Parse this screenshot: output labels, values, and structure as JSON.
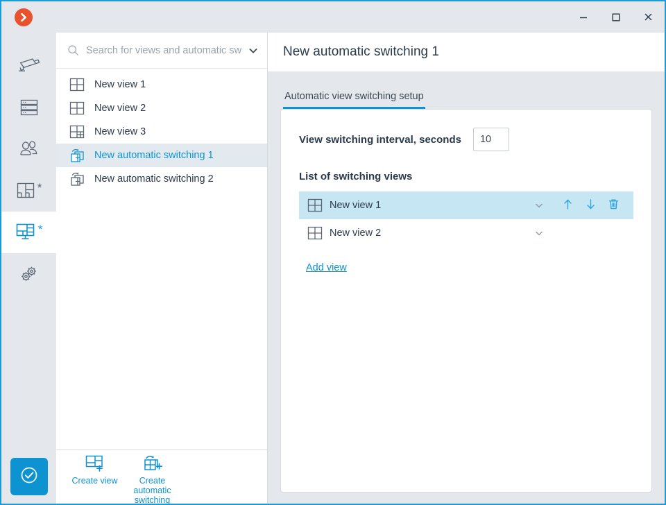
{
  "window": {
    "logo_icon": "chevron-right-circle-logo",
    "minimize_label": "—",
    "maximize_label": "□",
    "close_label": "✕"
  },
  "rail": {
    "items": [
      {
        "name": "cameras",
        "icon": "cctv-camera-icon",
        "star": "",
        "active": false
      },
      {
        "name": "servers",
        "icon": "server-stack-icon",
        "star": "",
        "active": false
      },
      {
        "name": "users",
        "icon": "users-group-icon",
        "star": "",
        "active": false
      },
      {
        "name": "layouts",
        "icon": "grid-layout-icon",
        "star": "*",
        "active": false
      },
      {
        "name": "workspaces",
        "icon": "monitor-layout-icon",
        "star": "*",
        "active": true
      },
      {
        "name": "settings",
        "icon": "gears-icon",
        "star": "",
        "active": false
      }
    ],
    "confirm_icon": "check-circle-icon"
  },
  "search": {
    "placeholder": "Search for views and automatic switchings",
    "value": "",
    "icon": "search-icon",
    "caret_icon": "chevron-down-icon"
  },
  "view_list": {
    "items": [
      {
        "label": "New view 1",
        "icon": "view-grid-icon",
        "selected": false
      },
      {
        "label": "New view 2",
        "icon": "view-grid-icon",
        "selected": false
      },
      {
        "label": "New view 3",
        "icon": "view-grid-split-icon",
        "selected": false
      },
      {
        "label": "New automatic switching 1",
        "icon": "auto-switching-icon",
        "selected": true
      },
      {
        "label": "New automatic switching 2",
        "icon": "auto-switching-icon",
        "selected": false
      }
    ]
  },
  "list_footer": {
    "buttons": [
      {
        "label": "Create view",
        "icon": "create-view-icon"
      },
      {
        "label": "Create automatic switching",
        "icon": "create-auto-switching-icon"
      }
    ]
  },
  "main": {
    "title": "New automatic switching 1",
    "tabs": [
      {
        "label": "Automatic view switching setup",
        "active": true
      }
    ],
    "interval": {
      "label": "View switching interval, seconds",
      "value": "10"
    },
    "list_section": {
      "title": "List of switching views",
      "rows": [
        {
          "label": "New view 1",
          "icon": "view-grid-icon",
          "selected": true,
          "chevron_icon": "chevron-down-icon",
          "actions": [
            {
              "name": "move-up",
              "icon": "arrow-up-icon"
            },
            {
              "name": "move-down",
              "icon": "arrow-down-icon"
            },
            {
              "name": "delete",
              "icon": "trash-icon"
            }
          ]
        },
        {
          "label": "New view 2",
          "icon": "view-grid-icon",
          "selected": false,
          "chevron_icon": "chevron-down-icon",
          "actions": []
        }
      ],
      "add_link": "Add view"
    }
  },
  "colors": {
    "accent": "#0d93d2",
    "window_border": "#1b9ad6",
    "logo": "#e8532e",
    "chrome_bg": "#e4e8ec",
    "row_selected": "#c6e6f4",
    "list_selected": "#e3eaef"
  }
}
